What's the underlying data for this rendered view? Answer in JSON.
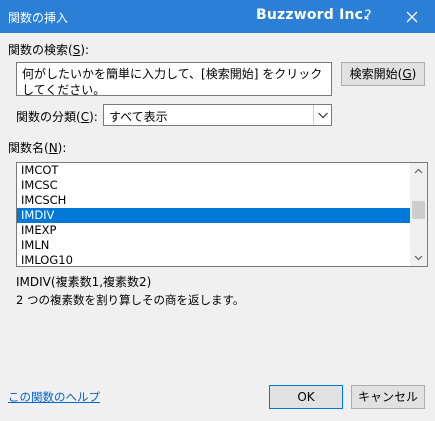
{
  "titlebar": {
    "title": "関数の挿入",
    "brand": "Buzzword Inc.",
    "help": "?"
  },
  "search": {
    "label_before": "関数の検索(",
    "label_key": "S",
    "label_after": "):",
    "value": "何がしたいかを簡単に入力して、[検索開始] をクリックしてください。",
    "button_before": "検索開始(",
    "button_key": "G",
    "button_after": ")"
  },
  "category": {
    "label_before": "関数の分類(",
    "label_key": "C",
    "label_after": "):",
    "selected": "すべて表示"
  },
  "function_list": {
    "label_before": "関数名(",
    "label_key": "N",
    "label_after": "):",
    "items": [
      "IMCOT",
      "IMCSC",
      "IMCSCH",
      "IMDIV",
      "IMEXP",
      "IMLN",
      "IMLOG10"
    ],
    "selected_index": 3
  },
  "details": {
    "syntax": "IMDIV(複素数1,複素数2)",
    "description": "2 つの複素数を割り算しその商を返します。"
  },
  "footer": {
    "help_link": "この関数のヘルプ",
    "ok_label": "OK",
    "cancel_label": "キャンセル"
  },
  "colors": {
    "titlebar": "#2b7fd4",
    "selection": "#0078d7",
    "link": "#0066cc"
  }
}
